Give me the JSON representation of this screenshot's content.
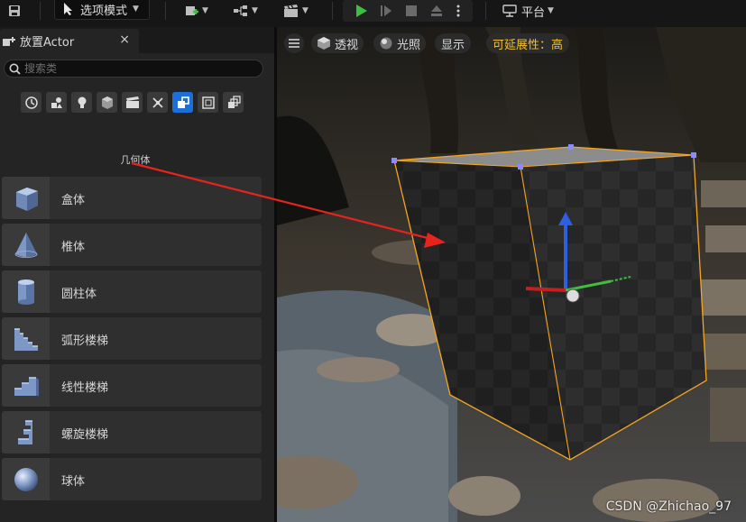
{
  "toolbar": {
    "mode_label": "选项模式",
    "platform_label": "平台"
  },
  "panel": {
    "tab_title": "放置Actor",
    "close_glyph": "×",
    "search_placeholder": "搜索类",
    "category_title": "几何体",
    "category_icons": [
      "recent-icon",
      "basic-icon",
      "lights-icon",
      "shapes-icon",
      "cinematic-icon",
      "visual-effects-icon",
      "geometry-icon",
      "volumes-icon",
      "all-classes-icon"
    ],
    "active_category": "geometry-icon",
    "items": [
      {
        "label": "盒体",
        "icon": "box-icon"
      },
      {
        "label": "椎体",
        "icon": "cone-icon"
      },
      {
        "label": "圆柱体",
        "icon": "cylinder-icon"
      },
      {
        "label": "弧形楼梯",
        "icon": "curved-stairs-icon"
      },
      {
        "label": "线性楼梯",
        "icon": "linear-stairs-icon"
      },
      {
        "label": "螺旋楼梯",
        "icon": "spiral-stairs-icon"
      },
      {
        "label": "球体",
        "icon": "sphere-icon"
      }
    ]
  },
  "viewport": {
    "perspective_label": "透视",
    "lit_label": "光照",
    "show_label": "显示",
    "scalability_label": "可延展性：高",
    "watermark": "CSDN @Zhichao_97"
  },
  "colors": {
    "accent_blue": "#1c6fd6",
    "play_green": "#3fbf3f",
    "highlight_yellow": "#f2c230",
    "selection_orange": "#f5a623",
    "annotation_red": "#e8231d"
  }
}
